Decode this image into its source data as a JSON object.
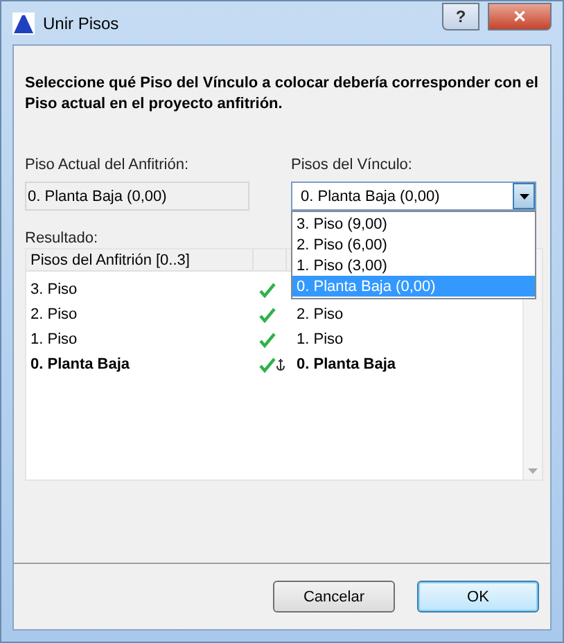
{
  "window": {
    "title": "Unir Pisos",
    "help_button": "?",
    "close_button": "✕"
  },
  "instruction": "Seleccione qué Piso del Vínculo a colocar debería corresponder con el Piso actual en el proyecto anfitrión.",
  "host_story": {
    "label": "Piso Actual del Anfitrión:",
    "value": "0. Planta Baja (0,00)"
  },
  "link_stories": {
    "label": "Pisos del Vínculo:",
    "value": "0. Planta Baja (0,00)",
    "expanded": true,
    "options": [
      {
        "label": "3. Piso (9,00)",
        "selected": false
      },
      {
        "label": "2. Piso (6,00)",
        "selected": false
      },
      {
        "label": "1. Piso (3,00)",
        "selected": false
      },
      {
        "label": "0. Planta Baja (0,00)",
        "selected": true
      }
    ]
  },
  "result": {
    "label": "Resultado:",
    "columns": [
      "Pisos del Anfitrión [0..3]"
    ],
    "rows": [
      {
        "host": "3. Piso",
        "matched": true,
        "anchored": false,
        "current": false
      },
      {
        "host": "2. Piso",
        "matched": true,
        "anchored": false,
        "current": false,
        "link": "2. Piso"
      },
      {
        "host": "1. Piso",
        "matched": true,
        "anchored": false,
        "current": false,
        "link": "1. Piso"
      },
      {
        "host": "0. Planta Baja",
        "matched": true,
        "anchored": true,
        "current": true,
        "link": "0. Planta Baja"
      }
    ]
  },
  "buttons": [
    {
      "label": "Cancelar",
      "default": false
    },
    {
      "label": "OK",
      "default": true
    }
  ]
}
